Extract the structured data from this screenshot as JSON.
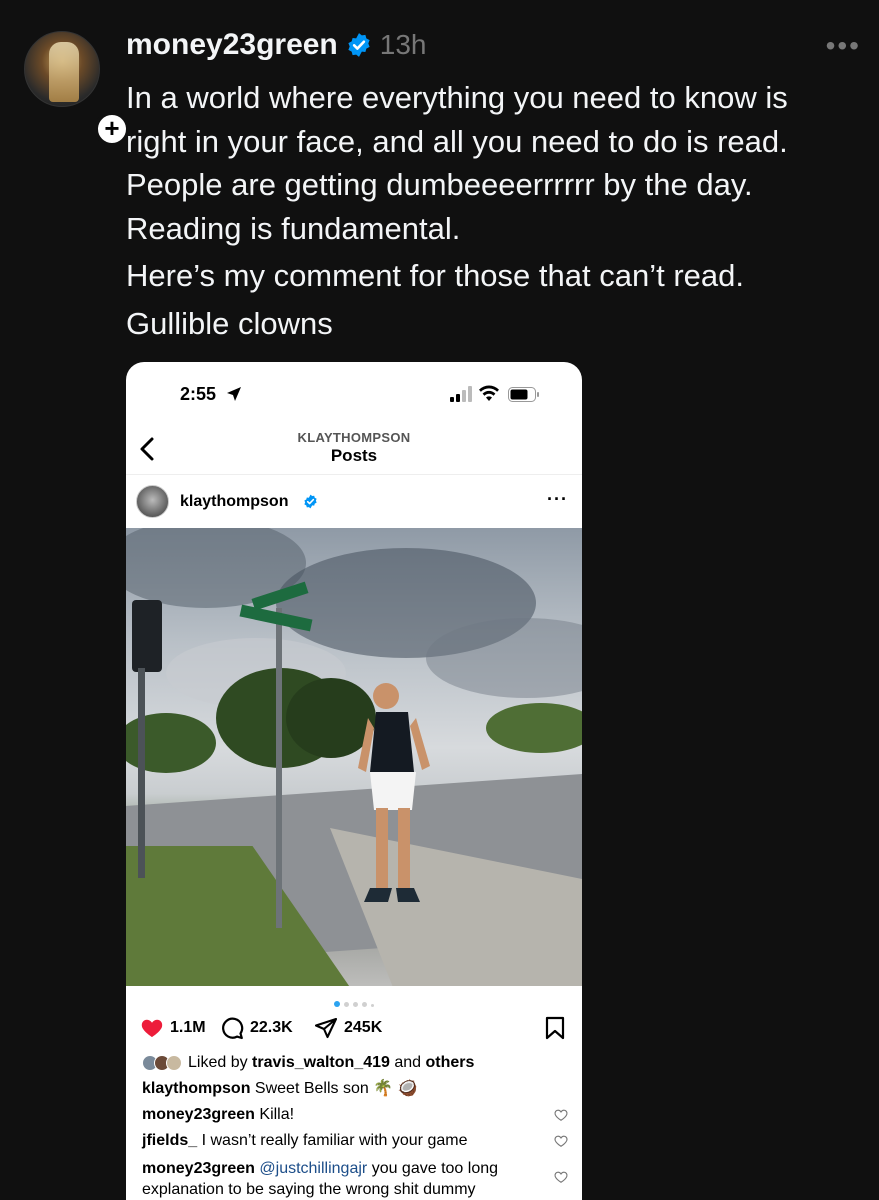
{
  "post": {
    "username": "money23green",
    "time": "13h",
    "lines": [
      "In a world where everything you need to know is right in your face, and all you need to do is read. People are getting dumbeeeerrrrrr by the day.",
      "Reading is fundamental.",
      "Here’s my comment for those that can’t read.",
      "Gullible clowns"
    ],
    "more_icon": "more-horizontal-icon",
    "follow_icon": "plus-icon"
  },
  "embed": {
    "status": {
      "time": "2:55"
    },
    "nav": {
      "account": "KLAYTHOMPSON",
      "title": "Posts"
    },
    "account": {
      "name": "klaythompson"
    },
    "carousel": {
      "current": 1,
      "count": 5
    },
    "actions": {
      "likes": "1.1M",
      "comments": "22.3K",
      "shares": "245K"
    },
    "liked_by": {
      "prefix": "Liked by",
      "user": "travis_walton_419",
      "middle": "and",
      "suffix": "others"
    },
    "caption": {
      "user": "klaythompson",
      "text": "Sweet Bells son 🌴 🥥"
    },
    "comments": [
      {
        "user": "money23green",
        "text": "Killa!"
      },
      {
        "user": "jfields_",
        "text": "I wasn’t really familiar with your game"
      },
      {
        "user": "money23green",
        "mention": "@justchillingajr",
        "text": "you gave too long explanation to be saying the wrong shit dummy"
      }
    ]
  },
  "colors": {
    "background": "#101010",
    "verified": "#0095f6",
    "like": "#ed1c3a",
    "mention": "#1d4e89"
  }
}
